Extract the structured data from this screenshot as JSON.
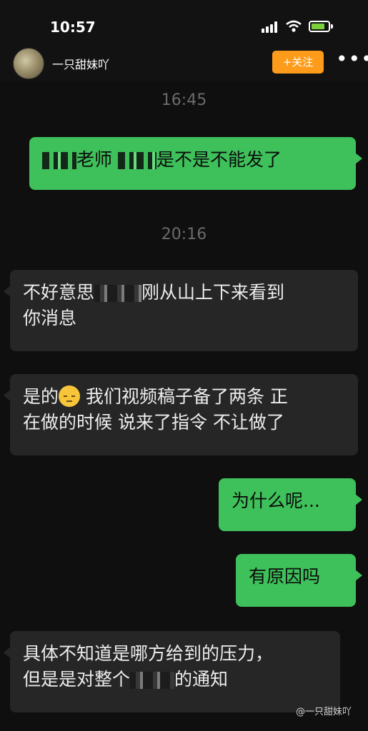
{
  "status_bar": {
    "time": "10:57"
  },
  "header": {
    "username": "一只甜妹吖",
    "follow_label": "+关注",
    "more_label": "•••"
  },
  "messages": [
    {
      "type": "timestamp",
      "text": "16:45"
    },
    {
      "type": "out",
      "parts": [
        "",
        "老师",
        "",
        "是不是不能发了"
      ]
    },
    {
      "type": "timestamp",
      "text": "20:16"
    },
    {
      "type": "in",
      "line1_a": "不好意思",
      "line1_b": "刚从山上下来看到",
      "line2": "你消息"
    },
    {
      "type": "in",
      "line1_a": "是的",
      "line1_b": " 我们视频稿子备了两条 正",
      "line2": "在做的时候 说来了指令 不让做了"
    },
    {
      "type": "out",
      "text": "为什么呢..."
    },
    {
      "type": "out",
      "text": "有原因吗"
    },
    {
      "type": "in",
      "line1": "具体不知道是哪方给到的压力，",
      "line2_a": "但是是对整个",
      "line2_b": "的通知"
    }
  ],
  "watermark": "@一只甜妹吖",
  "colors": {
    "outgoing": "#3ec05a",
    "incoming": "#262626",
    "follow": "#ff9b1a"
  }
}
